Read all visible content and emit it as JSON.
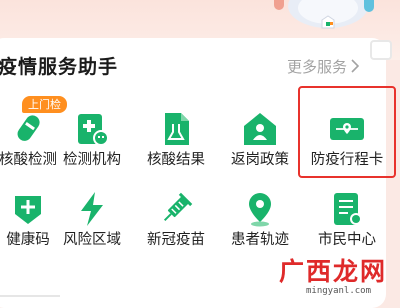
{
  "section": {
    "title": "疫情服务助手",
    "more_label": "更多服务"
  },
  "services": [
    {
      "label": "核酸检测",
      "badge": "上门检",
      "icon": "test-tube-icon"
    },
    {
      "label": "检测机构",
      "icon": "medical-institution-icon"
    },
    {
      "label": "核酸结果",
      "icon": "test-result-document-icon"
    },
    {
      "label": "返岗政策",
      "icon": "house-person-icon"
    },
    {
      "label": "防疫行程卡",
      "icon": "travel-card-icon",
      "highlighted": true
    },
    {
      "label": "健康码",
      "icon": "health-code-icon"
    },
    {
      "label": "风险区域",
      "icon": "lightning-icon"
    },
    {
      "label": "新冠疫苗",
      "icon": "syringe-icon"
    },
    {
      "label": "患者轨迹",
      "icon": "map-pin-icon"
    },
    {
      "label": "市民中心",
      "icon": "citizen-center-icon"
    }
  ],
  "watermark": {
    "text": "广西龙网",
    "url": "mingyanl.com"
  },
  "colors": {
    "accent": "#19b36b",
    "highlight_border": "#e8322c",
    "badge": "#ff8f1f"
  }
}
